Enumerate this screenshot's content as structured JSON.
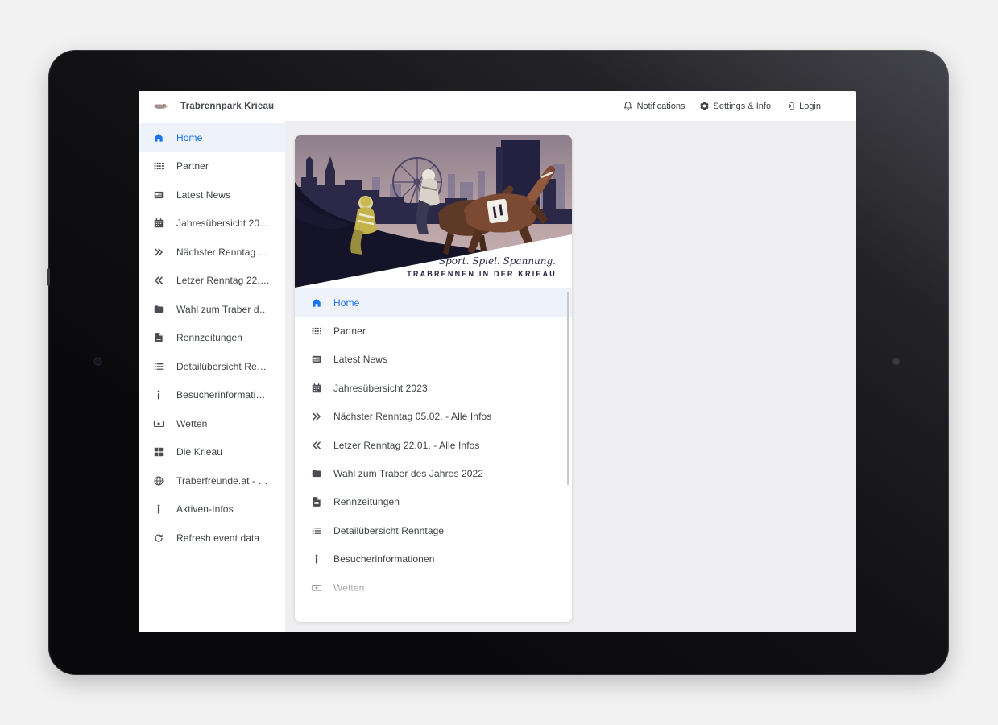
{
  "app": {
    "title": "Trabrennpark Krieau",
    "topbar": {
      "notifications_label": "Notifications",
      "settings_label": "Settings & Info",
      "login_label": "Login"
    },
    "colors": {
      "accent": "#1a73e8",
      "text": "#3c4043",
      "active_item_bg": "#eef2fa",
      "main_bg": "#efeff1"
    },
    "sidebar": {
      "items": [
        {
          "id": "home",
          "label": "Home",
          "icon": "home",
          "active": true
        },
        {
          "id": "partner",
          "label": "Partner",
          "icon": "apps"
        },
        {
          "id": "latest-news",
          "label": "Latest News",
          "icon": "news"
        },
        {
          "id": "jahresuebersicht",
          "label": "Jahresübersicht 20…",
          "icon": "calendar"
        },
        {
          "id": "naechster-renntag",
          "label": "Nächster Renntag …",
          "icon": "dblright"
        },
        {
          "id": "letzer-renntag",
          "label": "Letzer Renntag 22.…",
          "icon": "dblleft"
        },
        {
          "id": "wahl-zum-traber",
          "label": "Wahl zum Traber d…",
          "icon": "folder"
        },
        {
          "id": "rennzeitungen",
          "label": "Rennzeitungen",
          "icon": "document"
        },
        {
          "id": "detailuebersicht",
          "label": "Detailübersicht Re…",
          "icon": "list"
        },
        {
          "id": "besucherinfo",
          "label": "Besucherinformati…",
          "icon": "info"
        },
        {
          "id": "wetten",
          "label": "Wetten",
          "icon": "bet"
        },
        {
          "id": "die-krieau",
          "label": "Die Krieau",
          "icon": "grid2"
        },
        {
          "id": "traberfreunde",
          "label": "Traberfreunde.at - …",
          "icon": "globe"
        },
        {
          "id": "aktiven-infos",
          "label": "Aktiven-Infos",
          "icon": "info"
        },
        {
          "id": "refresh-event-data",
          "label": "Refresh event data",
          "icon": "refresh"
        }
      ]
    },
    "hero": {
      "tagline_script": "Sport. Spiel. Spannung.",
      "tagline_caps": "TRABRENNEN IN DER KRIEAU"
    },
    "menu": {
      "items": [
        {
          "id": "home",
          "label": "Home",
          "icon": "home",
          "active": true
        },
        {
          "id": "partner",
          "label": "Partner",
          "icon": "apps"
        },
        {
          "id": "latest-news",
          "label": "Latest News",
          "icon": "news"
        },
        {
          "id": "jahresuebersicht",
          "label": "Jahresübersicht 2023",
          "icon": "calendar"
        },
        {
          "id": "naechster-renntag",
          "label": "Nächster Renntag 05.02. - Alle Infos",
          "icon": "dblright"
        },
        {
          "id": "letzer-renntag",
          "label": "Letzer Renntag 22.01. - Alle Infos",
          "icon": "dblleft"
        },
        {
          "id": "wahl-zum-traber",
          "label": "Wahl zum Traber des Jahres 2022",
          "icon": "folder"
        },
        {
          "id": "rennzeitungen",
          "label": "Rennzeitungen",
          "icon": "document"
        },
        {
          "id": "detailuebersicht",
          "label": "Detailübersicht Renntage",
          "icon": "list"
        },
        {
          "id": "besucherinfo",
          "label": "Besucherinformationen",
          "icon": "info"
        },
        {
          "id": "wetten",
          "label": "Wetten",
          "icon": "bet"
        }
      ]
    }
  }
}
